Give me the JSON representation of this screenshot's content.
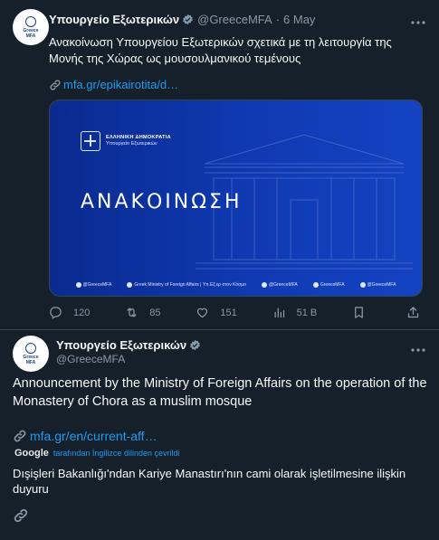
{
  "tweet1": {
    "name": "Υπουργείο Εξωτερικών",
    "handle": "@GreeceMFA",
    "sep": "·",
    "date": "6 May",
    "text": "Ανακοίνωση Υπουργείου Εξωτερικών σχετικά με τη λειτουργία της Μονής της Χώρας ως μουσουλμανικού τεμένους",
    "link": "mfa.gr/epikairotita/d…",
    "card": {
      "org_line1": "ΕΛΛΗΝΙΚΗ ΔΗΜΟΚΡΑΤΙΑ",
      "org_line2": "Υπουργείο Εξωτερικών",
      "title": "ΑΝΑΚΟΙΝΩΣΗ",
      "footer": [
        "@GreeceMFA",
        "Greek Ministry of Foreign Affairs | Υπ.Εξ.ερ στον Κόσμο",
        "@GreeceMFA",
        "GreeceMFA",
        "@GreeceMFA"
      ]
    },
    "actions": {
      "replies": "120",
      "reposts": "85",
      "likes": "151",
      "views": "51 B"
    }
  },
  "avatar": {
    "line1": "Greece",
    "line2": "MFA"
  },
  "tweet2": {
    "name": "Υπουργείο Εξωτερικών",
    "handle": "@GreeceMFA",
    "text": "Announcement by the Ministry of Foreign Affairs on the operation of the Monastery of Chora as a muslim mosque",
    "link": "mfa.gr/en/current-aff…",
    "translated_brand": "Google",
    "translated_label": "tarafından İngilizce dilinden çevrildi",
    "translated_text": "Dışişleri Bakanlığı'ndan Kariye Manastırı'nın cami olarak işletilmesine ilişkin duyuru"
  },
  "colors": {
    "background": "#15202b",
    "accent": "#1d9bf0",
    "muted": "#8b98a5",
    "card_blue": "#0f3ab3"
  },
  "icons": [
    "verified-badge-icon",
    "more-icon",
    "link-icon",
    "reply-icon",
    "repost-icon",
    "like-icon",
    "views-icon",
    "bookmark-icon",
    "share-icon"
  ]
}
